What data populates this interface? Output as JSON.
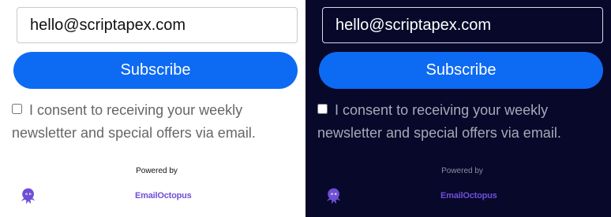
{
  "panels": [
    {
      "theme": "light",
      "email_value": "hello@scriptapex.com",
      "subscribe_label": "Subscribe",
      "consent_text": "I consent to receiving your weekly newsletter and special offers via email.",
      "powered_by": "Powered by",
      "brand_name": "EmailOctopus"
    },
    {
      "theme": "dark",
      "email_value": "hello@scriptapex.com",
      "subscribe_label": "Subscribe",
      "consent_text": "I consent to receiving your weekly newsletter and special offers via email.",
      "powered_by": "Powered by",
      "brand_name": "EmailOctopus"
    }
  ],
  "icons": {
    "octopus": "octopus-icon"
  },
  "colors": {
    "button": "#0d6af3",
    "brand": "#6f4fd8",
    "dark_background": "#07082a",
    "light_background": "#ffffff"
  }
}
